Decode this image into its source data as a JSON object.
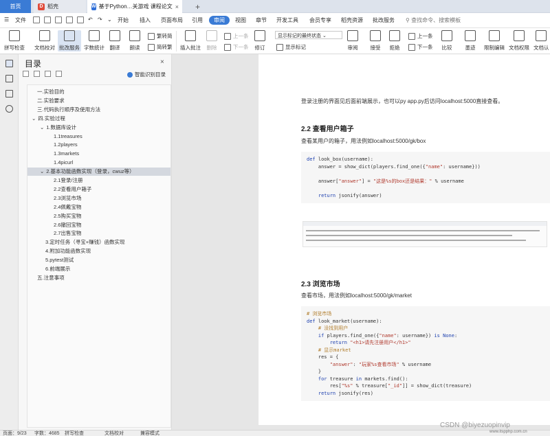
{
  "tabs": {
    "home": "首页",
    "store": "稻壳",
    "doc": "基于Python…关游戏 课程论文"
  },
  "menu": {
    "file": "文件",
    "items": [
      "开始",
      "插入",
      "页面布局",
      "引用",
      "审阅",
      "视图",
      "章节",
      "开发工具",
      "会员专享",
      "稻壳资源",
      "批改服务"
    ],
    "active_index": 4,
    "search": "查找命令、搜索模板"
  },
  "ribbon": {
    "spell": "拼写检查",
    "proof": "文档校对",
    "correct": "批改服务",
    "count": "字数统计",
    "translate": "翻译",
    "read": "朗读",
    "trad": "繁转简",
    "simp": "简转繁",
    "insert_comment": "插入批注",
    "delete": "删除",
    "prev": "上一条",
    "next": "下一条",
    "revise": "修订",
    "markup_select": "显示标记的最终状态",
    "show_markup": "显示标记",
    "review": "审阅",
    "accept": "接受",
    "reject": "拒绝",
    "prev2": "上一条",
    "next2": "下一条",
    "compare": "比较",
    "ink": "墨迹",
    "restrict": "限制编辑",
    "rights": "文档权限",
    "auth": "文档认"
  },
  "toc": {
    "title": "目录",
    "smart": "智能识别目录",
    "items": [
      {
        "label": "一.实验目的",
        "level": 0
      },
      {
        "label": "二.实验要求",
        "level": 0
      },
      {
        "label": "三.代码执行顺序及使用方法",
        "level": 0
      },
      {
        "label": "四.实验过程",
        "level": 0,
        "arrow": "⌄"
      },
      {
        "label": "1.数据库设计",
        "level": 1,
        "arrow": "⌄"
      },
      {
        "label": "1.1treasures",
        "level": 2
      },
      {
        "label": "1.2players",
        "level": 2
      },
      {
        "label": "1.3markets",
        "level": 2
      },
      {
        "label": "1.4picurl",
        "level": 2
      },
      {
        "label": "2.基本功能函数实现（登录，cwuz等）",
        "level": 1,
        "arrow": "⌄",
        "highlight": true
      },
      {
        "label": "2.1登录/注册",
        "level": 2
      },
      {
        "label": "2.2查看用户箱子",
        "level": 2
      },
      {
        "label": "2.3浏览市场",
        "level": 2
      },
      {
        "label": "2.4佩戴宝物",
        "level": 2
      },
      {
        "label": "2.5购买宝物",
        "level": 2
      },
      {
        "label": "2.6撤回宝物",
        "level": 2
      },
      {
        "label": "2.7出售宝物",
        "level": 2
      },
      {
        "label": "3.定时任务（寻宝+赚钱）函数实现",
        "level": 1
      },
      {
        "label": "4.附加功能函数实现",
        "level": 1
      },
      {
        "label": "5.pytest测试",
        "level": 1
      },
      {
        "label": "6.前端展示",
        "level": 1
      },
      {
        "label": "五.注意事项",
        "level": 0
      }
    ]
  },
  "doc": {
    "line1": "登录注册的界面见后面前端展示，也可以py app.py后访问localhost:5000直接查看。",
    "h22": "2.2 查看用户箱子",
    "p22": "查看某用户的箱子，用法例如localhost:5000/gk/box",
    "code1": [
      [
        [
          "kw",
          "def "
        ],
        [
          "",
          "look_box(username):"
        ]
      ],
      [
        [
          "",
          "    answer = show_dict(players.find_one({"
        ],
        [
          "st",
          "\"name\""
        ],
        [
          "",
          ": username}))"
        ]
      ],
      [
        [
          "",
          ""
        ]
      ],
      [
        [
          "",
          "    answer["
        ],
        [
          "st",
          "\"answer\""
        ],
        [
          "",
          "] = "
        ],
        [
          "st",
          "\"这是%s的box还是结果：\""
        ],
        [
          "",
          " % username"
        ]
      ],
      [
        [
          "",
          ""
        ]
      ],
      [
        [
          "kw",
          "    return "
        ],
        [
          "",
          "jsonify(answer)"
        ]
      ]
    ],
    "h23": "2.3 浏览市场",
    "p23": "查看市场，用法例如localhost:5000/gk/market",
    "code2": [
      [
        [
          "cm",
          "# 浏览市场"
        ]
      ],
      [
        [
          "kw",
          "def "
        ],
        [
          "",
          "look_market(username):"
        ]
      ],
      [
        [
          "cm",
          "    # 没找到用户"
        ]
      ],
      [
        [
          "kw",
          "    if "
        ],
        [
          "",
          "players.find_one({"
        ],
        [
          "st",
          "\"name\""
        ],
        [
          "",
          ": username}) "
        ],
        [
          "kw",
          "is None"
        ],
        [
          "",
          ":"
        ]
      ],
      [
        [
          "kw",
          "        return "
        ],
        [
          "st",
          "\"<h1>请先注册用户</h1>\""
        ]
      ],
      [
        [
          "cm",
          "    # 显示market"
        ]
      ],
      [
        [
          "",
          "    res = {"
        ]
      ],
      [
        [
          "st",
          "        \"answer\""
        ],
        [
          "",
          ": "
        ],
        [
          "st",
          "\"玩家%s查看市场\""
        ],
        [
          "",
          " % username"
        ]
      ],
      [
        [
          "",
          "    }"
        ]
      ],
      [
        [
          "kw",
          "    for "
        ],
        [
          "",
          "treasure "
        ],
        [
          "kw",
          "in "
        ],
        [
          "",
          "markets.find():"
        ]
      ],
      [
        [
          "",
          "        res["
        ],
        [
          "st",
          "\"%s\""
        ],
        [
          "",
          " % treasure["
        ],
        [
          "st",
          "\"_id\""
        ],
        [
          "",
          "]] = show_dict(treasure)"
        ]
      ],
      [
        [
          "kw",
          "    return "
        ],
        [
          "",
          "jsonify(res)"
        ]
      ]
    ]
  },
  "status": {
    "page": "页面：9/23",
    "words": "字数：4685",
    "spell": "拼写检查",
    "proof": "文档校对",
    "mode": "兼容模式"
  },
  "watermark": "CSDN @biyezuopinvip",
  "watermark2": "www.itspphp.com.cn"
}
